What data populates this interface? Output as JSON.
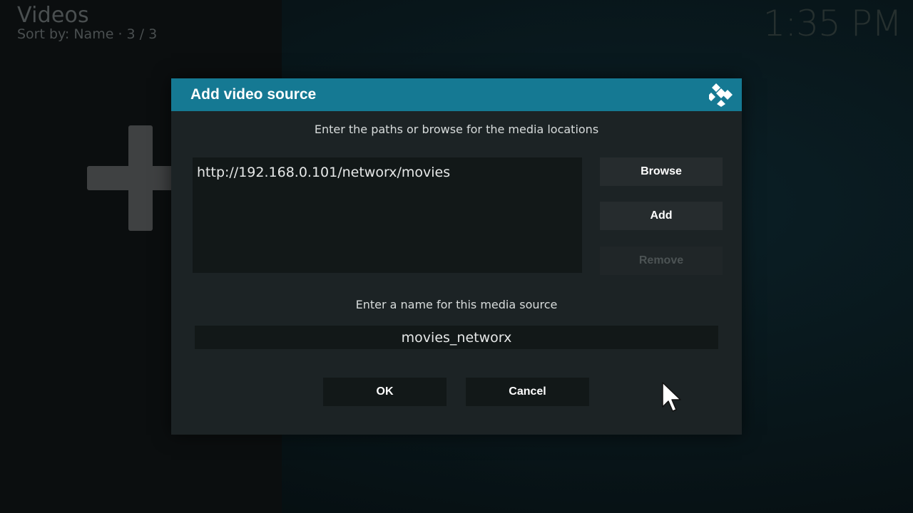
{
  "header": {
    "title": "Videos",
    "subtitle": "Sort by: Name  ·  3 / 3"
  },
  "clock": "1:35 PM",
  "background": {
    "add_icon": "plus-icon"
  },
  "dialog": {
    "title": "Add video source",
    "logo_icon": "kodi-logo-icon",
    "paths_prompt": "Enter the paths or browse for the media locations",
    "paths": [
      "http://192.168.0.101/networx/movies"
    ],
    "buttons": {
      "browse": "Browse",
      "add": "Add",
      "remove": "Remove"
    },
    "name_prompt": "Enter a name for this media source",
    "name_value": "movies_networx",
    "ok": "OK",
    "cancel": "Cancel"
  },
  "colors": {
    "header_accent": "#157993",
    "dialog_bg": "#1c2325",
    "button_bg": "#262c2e",
    "disabled_text": "#4c5354"
  }
}
